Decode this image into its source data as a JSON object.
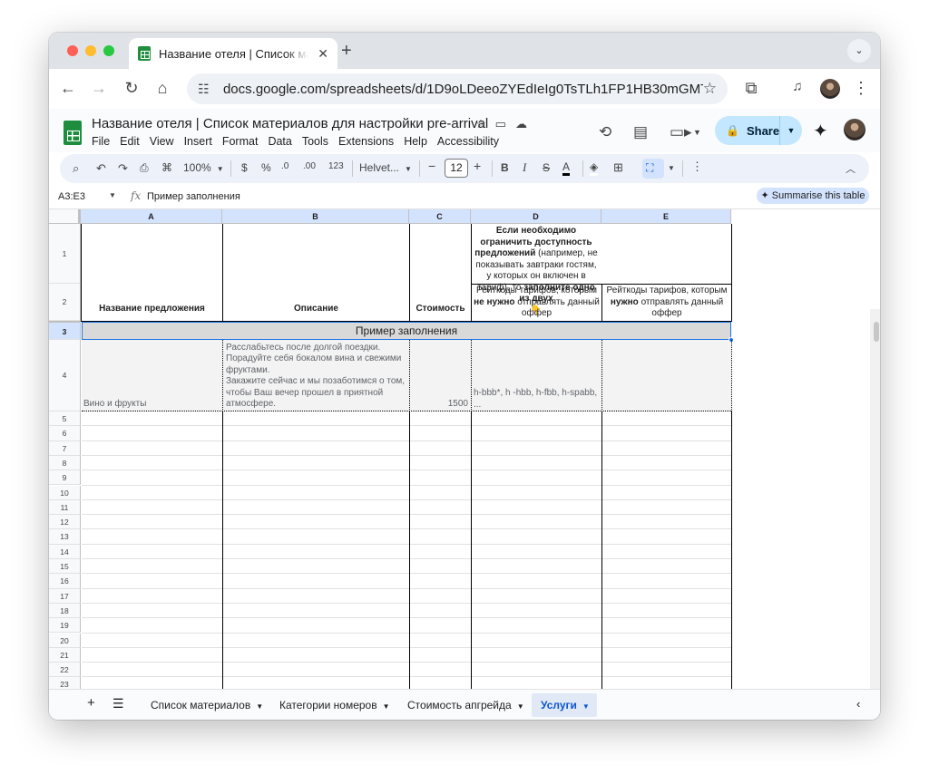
{
  "browser": {
    "tab_title": "Название отеля | Список материалов",
    "url": "docs.google.com/spreadsheets/d/1D9oLDeeoZYEdIeIg0TsTLh1FP1HB30mGMT8..."
  },
  "doc": {
    "title": "Название отеля | Список материалов для настройки pre-arrival",
    "menu": [
      "File",
      "Edit",
      "View",
      "Insert",
      "Format",
      "Data",
      "Tools",
      "Extensions",
      "Help",
      "Accessibility"
    ],
    "share_label": "Share"
  },
  "toolbar": {
    "zoom": "100%",
    "currency": "$",
    "percent": "%",
    "decrease_decimal": ".0",
    "increase_decimal": ".00",
    "number_format": "123",
    "font": "Helvet...",
    "font_size": "12",
    "minus": "−",
    "plus": "+",
    "bold": "B",
    "italic": "I",
    "strikethrough": "S",
    "text_color": "A"
  },
  "formula_bar": {
    "name_box": "A3:E3",
    "fx": "fx",
    "content": "Пример заполнения",
    "summarise": "✦ Summarise this table"
  },
  "sheet": {
    "columns": [
      "A",
      "B",
      "C",
      "D",
      "E"
    ],
    "rows": [
      "1",
      "2",
      "3",
      "4",
      "5",
      "6",
      "7",
      "8",
      "9",
      "10",
      "11",
      "12",
      "13",
      "14",
      "15",
      "16",
      "17",
      "18",
      "19",
      "20",
      "21",
      "22",
      "23"
    ],
    "header": {
      "a": "Название предложения",
      "b": "Описание",
      "c": "Стоимость",
      "d1_bold": "Если необходимо ограничить доступность предложений",
      "d1_normal": " (например, не показывать завтраки гостям, у которых он включен в тариф), то ",
      "d1_bold2": "заполните одно из двух",
      "d1_emoji": "👇",
      "d2_pre": "Рейткоды тарифов, которым ",
      "d2_bold": "не нужно",
      "d2_post": " отправлять данный оффер",
      "e2_pre": "Рейткоды тарифов, которым ",
      "e2_bold": "нужно",
      "e2_post": " отправлять данный оффер"
    },
    "example_row": "Пример заполнения",
    "row4": {
      "a": "Вино и фрукты",
      "b": "Расслабьтесь после долгой поездки. Порадуйте себя бокалом вина и свежими фруктами.\nЗакажите сейчас и мы позаботимся о том, чтобы Ваш вечер прошел в приятной атмосфере.",
      "c": "1500",
      "d": "h-bbb*, h -hbb, h-fbb, h-spabb, ..."
    }
  },
  "sheet_tabs": [
    "Список материалов",
    "Категории номеров",
    "Стоимость апгрейда",
    "Услуги"
  ],
  "active_sheet": "Услуги",
  "colors": {
    "selection": "#d3e3fd",
    "accent": "#0b57d0",
    "sheets_green": "#1e8e3e",
    "share": "#c2e7ff"
  }
}
